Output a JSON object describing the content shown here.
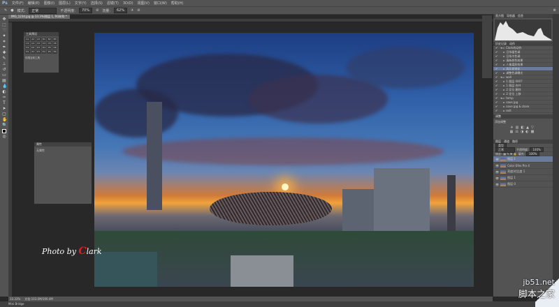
{
  "app": {
    "logo": "Ps"
  },
  "menu": [
    "文件(F)",
    "编辑(E)",
    "图像(I)",
    "图层(L)",
    "文字(Y)",
    "选择(S)",
    "滤镜(T)",
    "3D(D)",
    "视图(V)",
    "窗口(W)",
    "帮助(H)"
  ],
  "options": {
    "mode_label": "模式:",
    "mode_value": "正常",
    "opacity_label": "不透明度:",
    "opacity_value": "70%",
    "flow_label": "流量:",
    "flow_value": "62%"
  },
  "document": {
    "tab_title": "IMG_1234.jpg @ 33.3%(图层 1, RGB/8) *",
    "zoom": "33.33%",
    "doc_size": "文档:103.0M/190.4M"
  },
  "presets_panel": {
    "title": "工具预设",
    "cells": [
      "A1",
      "A2",
      "A3",
      "B1",
      "B2",
      "B3",
      "C1",
      "C2",
      "C3",
      "C4",
      "C5",
      "C6",
      "D1",
      "D2",
      "D3",
      "D4",
      "D5",
      "D6",
      "E1",
      "E2",
      "E3",
      "E4",
      "E5",
      "E6"
    ],
    "footer": "仅限当前工具"
  },
  "properties_panel": {
    "title": "属性",
    "body": "无属性"
  },
  "histogram_panel": {
    "tabs": [
      "直方图",
      "导航器",
      "信息"
    ]
  },
  "actions_panel": {
    "tabs": [
      "历史记录",
      "动作"
    ],
    "items": [
      "Clark的动作",
      "日系暖色调",
      "日系冷色调",
      "清新颜色效果",
      "人像柔肤效果",
      "高反差锐化",
      "调整色调曝光",
      "wall",
      "1 图层 0007",
      "1 图层 合并",
      "2 定位 删除",
      "2 定位 上移",
      "temp",
      "save jpg",
      "save jpg & close",
      "exit"
    ]
  },
  "adjust_panel": {
    "title": "调整",
    "sub": "添加调整"
  },
  "layers_panel": {
    "tabs": [
      "图层",
      "通道",
      "路径"
    ],
    "kind": "类型",
    "blend": "正常",
    "opacity_label": "不透明度:",
    "opacity_value": "100%",
    "lock_label": "锁定:",
    "fill_label": "填充:",
    "fill_value": "100%",
    "layers": [
      {
        "name": "图层 1",
        "selected": true
      },
      {
        "name": "Color Efex Pro 4",
        "selected": false
      },
      {
        "name": "亮度/对比度 1",
        "selected": false
      },
      {
        "name": "图层 1",
        "selected": false
      },
      {
        "name": "图层 0",
        "selected": false
      }
    ]
  },
  "watermark": {
    "prefix": "Photo by ",
    "initial": "C",
    "rest": "lark"
  },
  "site": {
    "domain": "jb51.net",
    "name": "脚本之家"
  },
  "bottom": {
    "mini_bridge": "Mini Bridge"
  }
}
